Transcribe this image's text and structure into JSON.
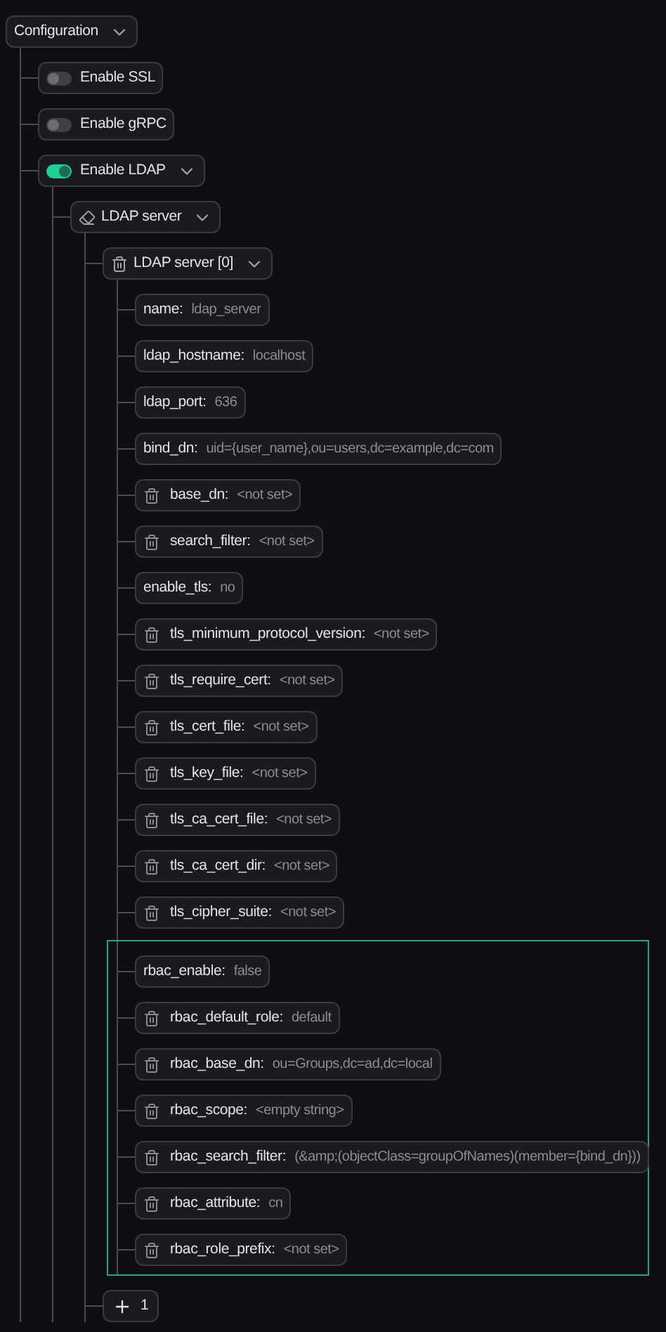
{
  "tree": {
    "kind": "dropdown",
    "label": "Configuration",
    "expanded": true,
    "children": [
      {
        "kind": "toggle",
        "label": "Enable SSL",
        "on": false
      },
      {
        "kind": "toggle",
        "label": "Enable gRPC",
        "on": false
      },
      {
        "kind": "toggle",
        "label": "Enable LDAP",
        "on": true,
        "expanded": true,
        "children": [
          {
            "kind": "section",
            "label": "LDAP server",
            "expanded": true,
            "children": [
              {
                "kind": "item",
                "label": "LDAP server [0]",
                "expanded": true,
                "children": [
                  {
                    "kind": "field",
                    "label": "name:",
                    "value": "ldap_server",
                    "deletable": false
                  },
                  {
                    "kind": "field",
                    "label": "ldap_hostname:",
                    "value": "localhost",
                    "deletable": false
                  },
                  {
                    "kind": "field",
                    "label": "ldap_port:",
                    "value": "636",
                    "deletable": false
                  },
                  {
                    "kind": "field",
                    "label": "bind_dn:",
                    "value": "uid={user_name},ou=users,dc=example,dc=com",
                    "deletable": false
                  },
                  {
                    "kind": "field",
                    "label": "base_dn:",
                    "value": "<not set>",
                    "deletable": true
                  },
                  {
                    "kind": "field",
                    "label": "search_filter:",
                    "value": "<not set>",
                    "deletable": true
                  },
                  {
                    "kind": "field",
                    "label": "enable_tls:",
                    "value": "no",
                    "deletable": false
                  },
                  {
                    "kind": "field",
                    "label": "tls_minimum_protocol_version:",
                    "value": "<not set>",
                    "deletable": true
                  },
                  {
                    "kind": "field",
                    "label": "tls_require_cert:",
                    "value": "<not set>",
                    "deletable": true
                  },
                  {
                    "kind": "field",
                    "label": "tls_cert_file:",
                    "value": "<not set>",
                    "deletable": true
                  },
                  {
                    "kind": "field",
                    "label": "tls_key_file:",
                    "value": "<not set>",
                    "deletable": true
                  },
                  {
                    "kind": "field",
                    "label": "tls_ca_cert_file:",
                    "value": "<not set>",
                    "deletable": true
                  },
                  {
                    "kind": "field",
                    "label": "tls_ca_cert_dir:",
                    "value": "<not set>",
                    "deletable": true
                  },
                  {
                    "kind": "field",
                    "label": "tls_cipher_suite:",
                    "value": "<not set>",
                    "deletable": true
                  },
                  {
                    "kind": "group",
                    "highlighted": true,
                    "children": [
                      {
                        "kind": "field",
                        "label": "rbac_enable:",
                        "value": "false",
                        "deletable": false
                      },
                      {
                        "kind": "field",
                        "label": "rbac_default_role:",
                        "value": "default",
                        "deletable": true
                      },
                      {
                        "kind": "field",
                        "label": "rbac_base_dn:",
                        "value": "ou=Groups,dc=ad,dc=local",
                        "deletable": true
                      },
                      {
                        "kind": "field",
                        "label": "rbac_scope:",
                        "value": "<empty string>",
                        "deletable": true
                      },
                      {
                        "kind": "field",
                        "label": "rbac_search_filter:",
                        "value": "(&amp;(objectClass=groupOfNames)(member={bind_dn}))",
                        "deletable": true
                      },
                      {
                        "kind": "field",
                        "label": "rbac_attribute:",
                        "value": "cn",
                        "deletable": true
                      },
                      {
                        "kind": "field",
                        "label": "rbac_role_prefix:",
                        "value": "<not set>",
                        "deletable": true
                      }
                    ]
                  }
                ]
              },
              {
                "kind": "add",
                "label": "1"
              }
            ]
          }
        ]
      }
    ]
  }
}
